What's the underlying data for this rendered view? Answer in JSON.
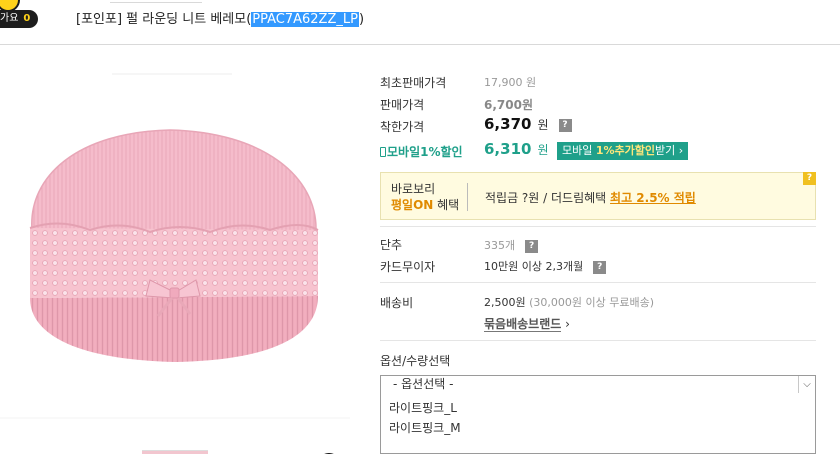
{
  "header": {
    "badge_label": "가요",
    "badge_count": "0",
    "title_prefix": "[포인포] 펄 라운딩 니트 베레모(",
    "title_code": "PPAC7A62ZZ_LP",
    "title_suffix": ")"
  },
  "prices": {
    "original_label": "최초판매가격",
    "original_value": "17,900 원",
    "sale_label": "판매가격",
    "sale_value": "6,700원",
    "good_label": "착한가격",
    "good_value": "6,370",
    "good_unit": "원",
    "mobile_label": "모바일1%할인",
    "mobile_value": "6,310",
    "mobile_unit": "원",
    "mobile_btn_prefix": "모바일 ",
    "mobile_btn_hi": "1%추가할인",
    "mobile_btn_suffix": "받기 ›"
  },
  "benefit": {
    "line1": "바로보리",
    "line2_hi": "평일ON",
    "line2": " 혜택",
    "text_prefix": "적립금 ?원 / 더드림혜택 ",
    "text_hi": "최고 2.5% 적립"
  },
  "details": {
    "stock_label": "단추",
    "stock_value": "335개",
    "card_label": "카드무이자",
    "card_value": "10만원 이상 2,3개월",
    "ship_label": "배송비",
    "ship_value": "2,500원",
    "ship_note": " (30,000원 이상 무료배송)",
    "bundle_link": "묶음배송브랜드",
    "bundle_arrow": "›"
  },
  "options": {
    "title": "옵션/수량선택",
    "selected": "- 옵션선택 -",
    "items": [
      "라이트핑크_L",
      "라이트핑크_M"
    ]
  },
  "icons": {
    "help": "?",
    "zoom": "+",
    "chevron": "⌵"
  },
  "colors": {
    "accent_green": "#1fa08a",
    "accent_orange": "#e08a00",
    "selection_blue": "#3399ff",
    "beret_pink": "#f2b6c3"
  }
}
